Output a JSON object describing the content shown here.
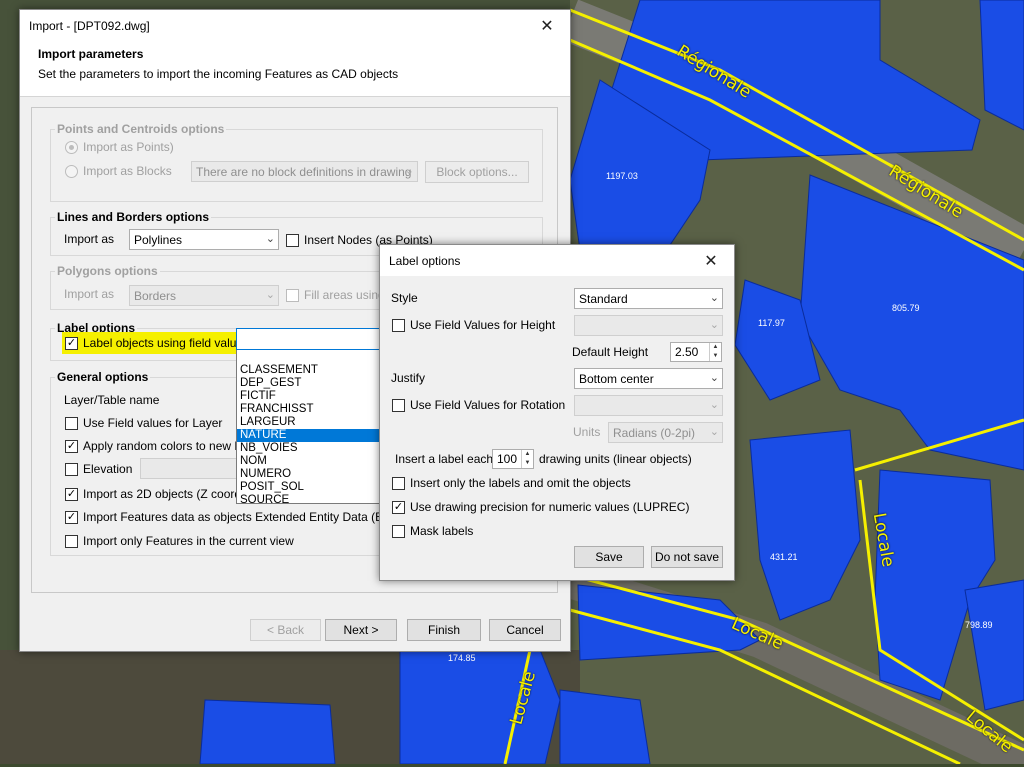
{
  "map": {
    "area_labels": [
      "1197.03",
      "805.79",
      "117.97",
      "431.21",
      "798.89",
      "174.85"
    ],
    "road_labels": [
      "Régionale",
      "Régionale",
      "Locale",
      "Locale",
      "Locale",
      "Locale"
    ]
  },
  "import_dialog": {
    "title": "Import - [DPT092.dwg]",
    "header_title": "Import parameters",
    "header_subtitle": "Set the parameters to import the incoming Features as CAD objects",
    "points": {
      "legend": "Points and Centroids options",
      "import_points": "Import as Points)",
      "import_blocks": "Import as Blocks",
      "block_combo": "There are no block definitions in drawing",
      "block_options": "Block options..."
    },
    "lines": {
      "legend": "Lines and Borders options",
      "import_as": "Import as",
      "combo": "Polylines",
      "insert_nodes": "Insert Nodes (as Points)"
    },
    "polygons": {
      "legend": "Polygons options",
      "import_as": "Import as",
      "combo": "Borders",
      "fill_areas": "Fill areas using"
    },
    "label": {
      "legend": "Label options",
      "label_objects": "Label objects using field value",
      "fields": [
        "CLASSEMENT",
        "DEP_GEST",
        "FICTIF",
        "FRANCHISST",
        "LARGEUR",
        "NATURE",
        "NB_VOIES",
        "NOM",
        "NUMERO",
        "POSIT_SOL",
        "SOURCE"
      ],
      "selected_field": "NATURE"
    },
    "general": {
      "legend": "General options",
      "layer_name": "Layer/Table name",
      "use_field_layer": "Use Field values for Layer",
      "random_colors": "Apply random colors to new Lay",
      "elevation": "Elevation",
      "import_2d": "Import as 2D objects (Z coordin",
      "import_features": "Import Features data as objects Extended Entity Data (EED)",
      "current_view": "Import only Features in the current view"
    },
    "buttons": {
      "back": "< Back",
      "next": "Next >",
      "finish": "Finish",
      "cancel": "Cancel"
    }
  },
  "label_dialog": {
    "title": "Label options",
    "style_label": "Style",
    "style_value": "Standard",
    "use_height": "Use Field Values for Height",
    "default_height_label": "Default Height",
    "default_height": "2.50",
    "justify_label": "Justify",
    "justify_value": "Bottom center",
    "use_rotation": "Use Field Values for Rotation",
    "units_label": "Units",
    "units_value": "Radians (0-2pi)",
    "insert_each": "Insert a label each",
    "insert_each_value": "100",
    "drawing_units": "drawing units (linear objects)",
    "insert_only": "Insert only the labels and omit the objects",
    "use_precision": "Use drawing precision for numeric values (LUPREC)",
    "mask_labels": "Mask labels",
    "save": "Save",
    "do_not_save": "Do not save"
  }
}
